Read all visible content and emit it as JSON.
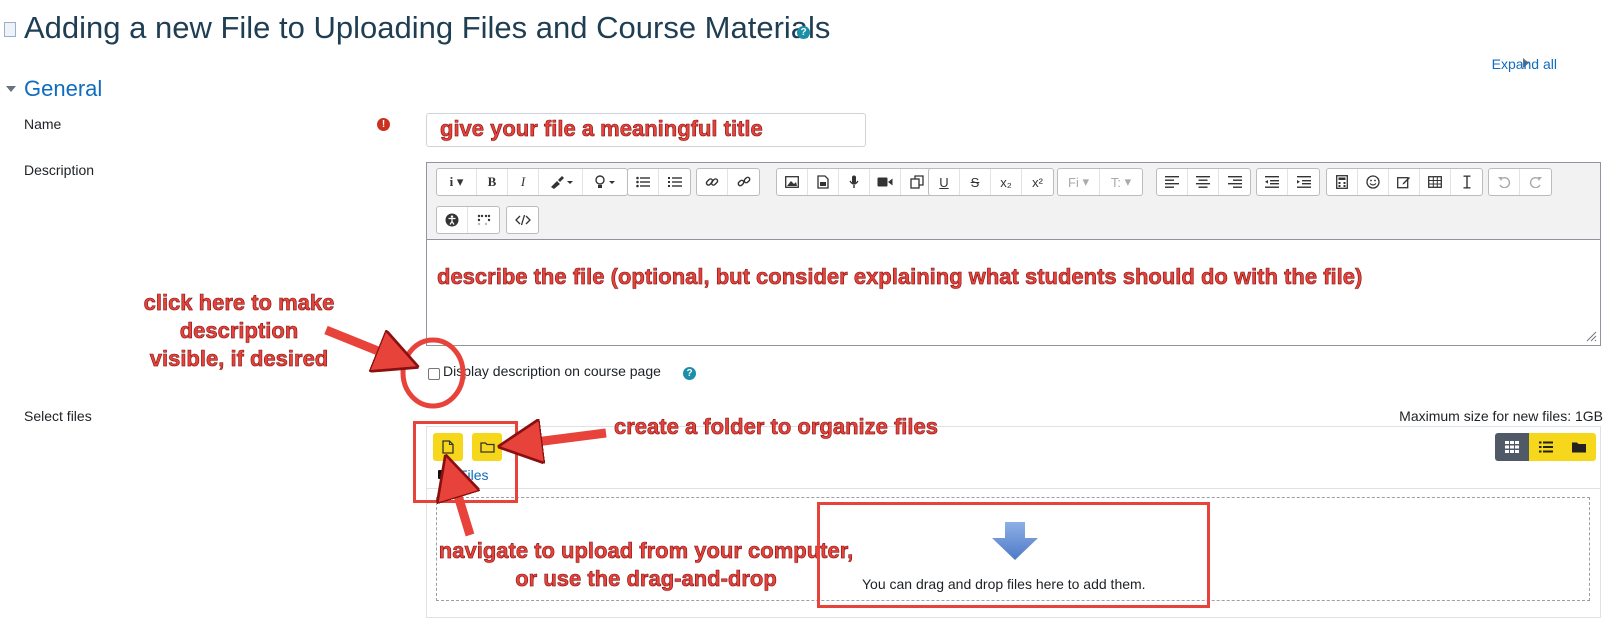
{
  "page": {
    "title": "Adding a new File to Uploading Files and Course Materials",
    "help_glyph": "?",
    "expand_all": "Expand all"
  },
  "section": {
    "title": "General"
  },
  "form": {
    "name_label": "Name",
    "required_glyph": "!",
    "description_label": "Description",
    "display_description_label": "Display description on course page",
    "select_files_label": "Select files",
    "max_size": "Maximum size for new files: 1GB",
    "files_breadcrumb": "Files",
    "drop_text": "You can drag and drop files here to add them."
  },
  "toolbar": {
    "bold": "B",
    "italic": "I",
    "info": "i",
    "underline": "U",
    "strike": "S",
    "subscript": "x₂",
    "superscript": "x²",
    "font_family": "Fi",
    "font_size": "T:"
  },
  "annotations": {
    "name_hint": "give your file a meaningful title",
    "description_hint": "describe the file (optional, but consider explaining what students should do with the file)",
    "visible_hint_line1": "click here to make",
    "visible_hint_line2": "description",
    "visible_hint_line3": "visible, if desired",
    "folder_hint": "create a folder to organize files",
    "upload_hint_line1": "navigate to upload from your computer,",
    "upload_hint_line2": "or use the drag-and-drop"
  },
  "colors": {
    "annotation_red": "#e8433b",
    "link_blue": "#0f6cbf",
    "button_yellow": "#f7d71b",
    "title_navy": "#1f3e53"
  }
}
